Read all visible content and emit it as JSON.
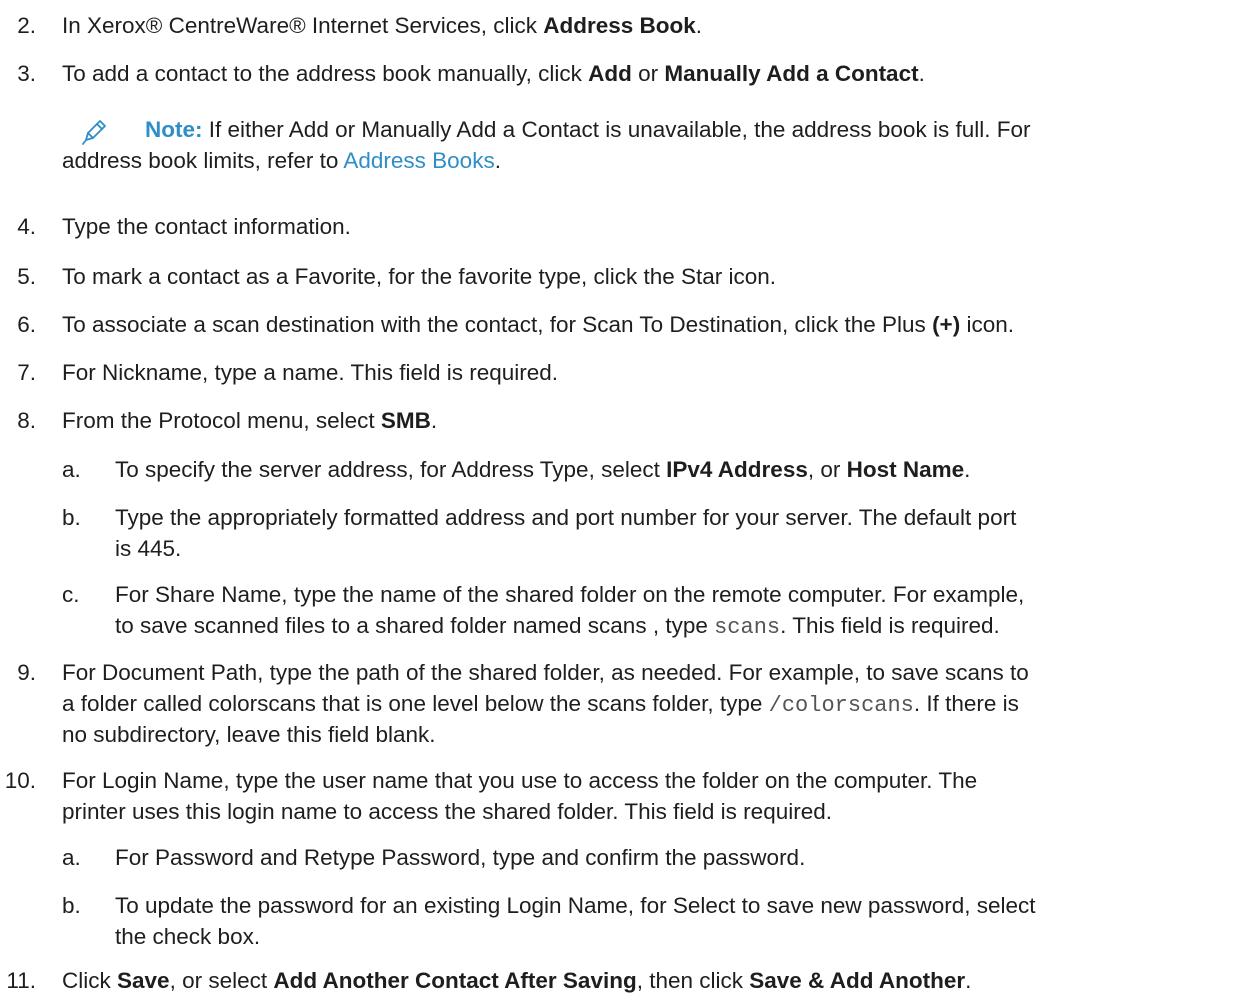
{
  "steps": {
    "s2": {
      "num": "2.",
      "a": "In Xerox® CentreWare® Internet Services, click ",
      "b1": "Address Book",
      "c": "."
    },
    "s3": {
      "num": "3.",
      "a": "To add a contact to the address book manually, click ",
      "b1": "Add",
      "m": " or ",
      "b2": "Manually Add a Contact",
      "c": "."
    },
    "note": {
      "label": "Note:",
      "line1": " If either Add or Manually Add a Contact is unavailable, the address book is full. For",
      "line2a": "address book limits, refer to ",
      "link": "Address Books",
      "line2b": "."
    },
    "s4": {
      "num": "4.",
      "text": "Type the contact information."
    },
    "s5": {
      "num": "5.",
      "text": "To mark a contact as a Favorite, for the favorite type, click the Star icon."
    },
    "s6": {
      "num": "6.",
      "a": "To associate a scan destination with the contact, for Scan To Destination, click the Plus ",
      "b1": "(+)",
      "c": " icon."
    },
    "s7": {
      "num": "7.",
      "text": "For Nickname, type a name. This field is required."
    },
    "s8": {
      "num": "8.",
      "a": "From the Protocol menu, select ",
      "b1": "SMB",
      "c": "."
    },
    "s8a": {
      "let": "a.",
      "a": "To specify the server address, for Address Type, select ",
      "b1": "IPv4 Address",
      "m": ", or ",
      "b2": "Host Name",
      "c": "."
    },
    "s8b": {
      "let": "b.",
      "line1": "Type the appropriately formatted address and port number for your server. The default port",
      "line2": "is 445."
    },
    "s8c": {
      "let": "c.",
      "line1": "For Share Name, type the name of the shared folder on the remote computer. For example,",
      "line2a": "to save scanned files to a shared folder named scans , type ",
      "code": "scans",
      "line2b": ". This field is required."
    },
    "s9": {
      "num": "9.",
      "line1": "For Document Path, type the path of the shared folder, as needed. For example, to save scans to",
      "line2a": "a folder called colorscans that is one level below the scans folder, type ",
      "code": "/colorscans",
      "line2b": ". If there is",
      "line3": "no subdirectory, leave this field blank."
    },
    "s10": {
      "num": "10.",
      "line1": "For Login Name, type the user name that you use to access the folder on the computer. The",
      "line2": "printer uses this login name to access the shared folder. This field is required."
    },
    "s10a": {
      "let": "a.",
      "text": "For Password and Retype Password, type and confirm the password."
    },
    "s10b": {
      "let": "b.",
      "line1": "To update the password for an existing Login Name, for Select to save new password, select",
      "line2": "the check box."
    },
    "s11": {
      "num": "11.",
      "a": "Click ",
      "b1": "Save",
      "m": ", or select ",
      "b2": "Add Another Contact After Saving",
      "m2": ", then click ",
      "b3": "Save & Add Another",
      "c": "."
    }
  },
  "icons": {
    "note": "pencil-icon"
  },
  "colors": {
    "accent": "#2f8ec8",
    "text": "#1e1e1e"
  }
}
